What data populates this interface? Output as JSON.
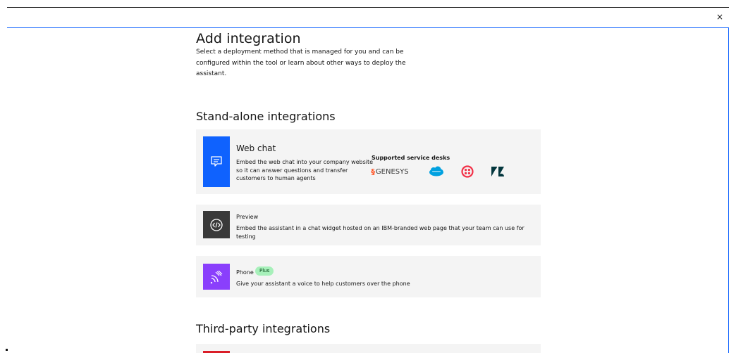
{
  "modal": {
    "close_glyph": "×"
  },
  "header": {
    "title": "Add integration",
    "description": "Select a deployment method that is managed for you and can be configured within the tool or learn about other ways to deploy the assistant."
  },
  "sections": {
    "standalone_title": "Stand-alone integrations",
    "third_party_title": "Third-party integrations"
  },
  "web_chat": {
    "title": "Web chat",
    "description": "Embed the web chat into your company website so it can answer questions and transfer customers to human agents",
    "icon": "chat-icon",
    "color": "#0f62fe",
    "service_desks_heading": "Supported service desks",
    "service_desks": [
      {
        "name": "GENESYS",
        "icon": "genesys-logo"
      },
      {
        "name": "salesforce",
        "icon": "salesforce-logo"
      },
      {
        "name": "twilio",
        "icon": "twilio-logo"
      },
      {
        "name": "zendesk",
        "icon": "zendesk-logo"
      }
    ]
  },
  "preview": {
    "title": "Preview",
    "description": "Embed the assistant in a chat widget hosted on an IBM-branded web page that your team can use for testing",
    "icon": "code-icon",
    "color": "#393939"
  },
  "phone": {
    "title": "Phone",
    "tag": "Plus",
    "description": "Give your assistant a voice to help customers over the phone",
    "icon": "phone-waves-icon",
    "color": "#8a3ffc"
  },
  "third_party_first": {
    "icon": "integration-icon",
    "color": "#da1e28"
  },
  "colors": {
    "accent": "#0f62fe",
    "tile_bg": "#f4f4f4",
    "plus_tag_bg": "#a7f0ba"
  }
}
